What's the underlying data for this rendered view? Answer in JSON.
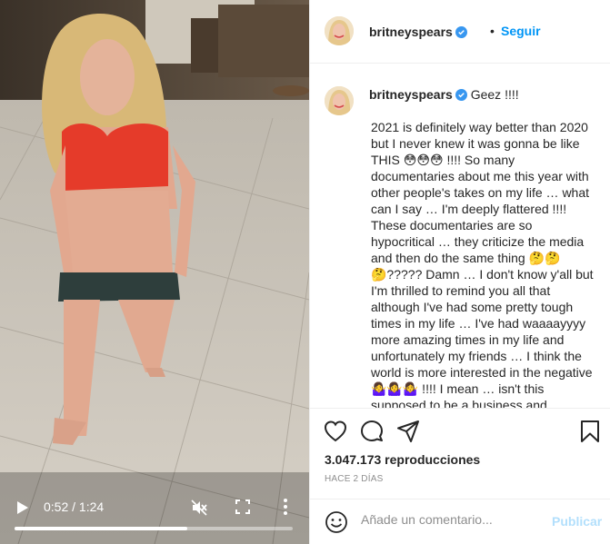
{
  "video": {
    "time": "0:52 / 1:24",
    "progress": 0.62,
    "icons": [
      "play-icon",
      "muted-icon",
      "fullscreen-icon",
      "more-vertical-icon"
    ]
  },
  "header": {
    "username": "britneyspears",
    "separator": "•",
    "follow_label": "Seguir"
  },
  "caption": {
    "username": "britneyspears",
    "title": "Geez !!!!",
    "body": "2021 is definitely way better than 2020 but I never knew it was gonna be like THIS 😳😳😳 !!!! So many documentaries about me this year with other people's takes on my life … what can I say … I'm deeply flattered !!!! These documentaries are so hypocritical … they criticize the media and then do the same thing 🤔🤔🤔????? Damn … I don't know y'all but I'm thrilled to remind you all that although I've had some pretty tough times in my life … I've had waaaayyyy more amazing times in my life and unfortunately my friends … I think the world is more interested in the negative 🤷‍♀️🤷‍♀️🤷‍♀️ !!!! I mean … isn't this supposed to be a business and"
  },
  "actions": {
    "icons": [
      "heart-icon",
      "comment-icon",
      "share-icon",
      "bookmark-icon"
    ],
    "views": "3.047.173 reproducciones",
    "time_ago": "HACE 2 DÍAS"
  },
  "comment": {
    "placeholder": "Añade un comentario...",
    "publish_label": "Publicar"
  },
  "colors": {
    "accent": "#0095f6",
    "publish_disabled": "#b2dffc",
    "verified": "#3897f0"
  }
}
